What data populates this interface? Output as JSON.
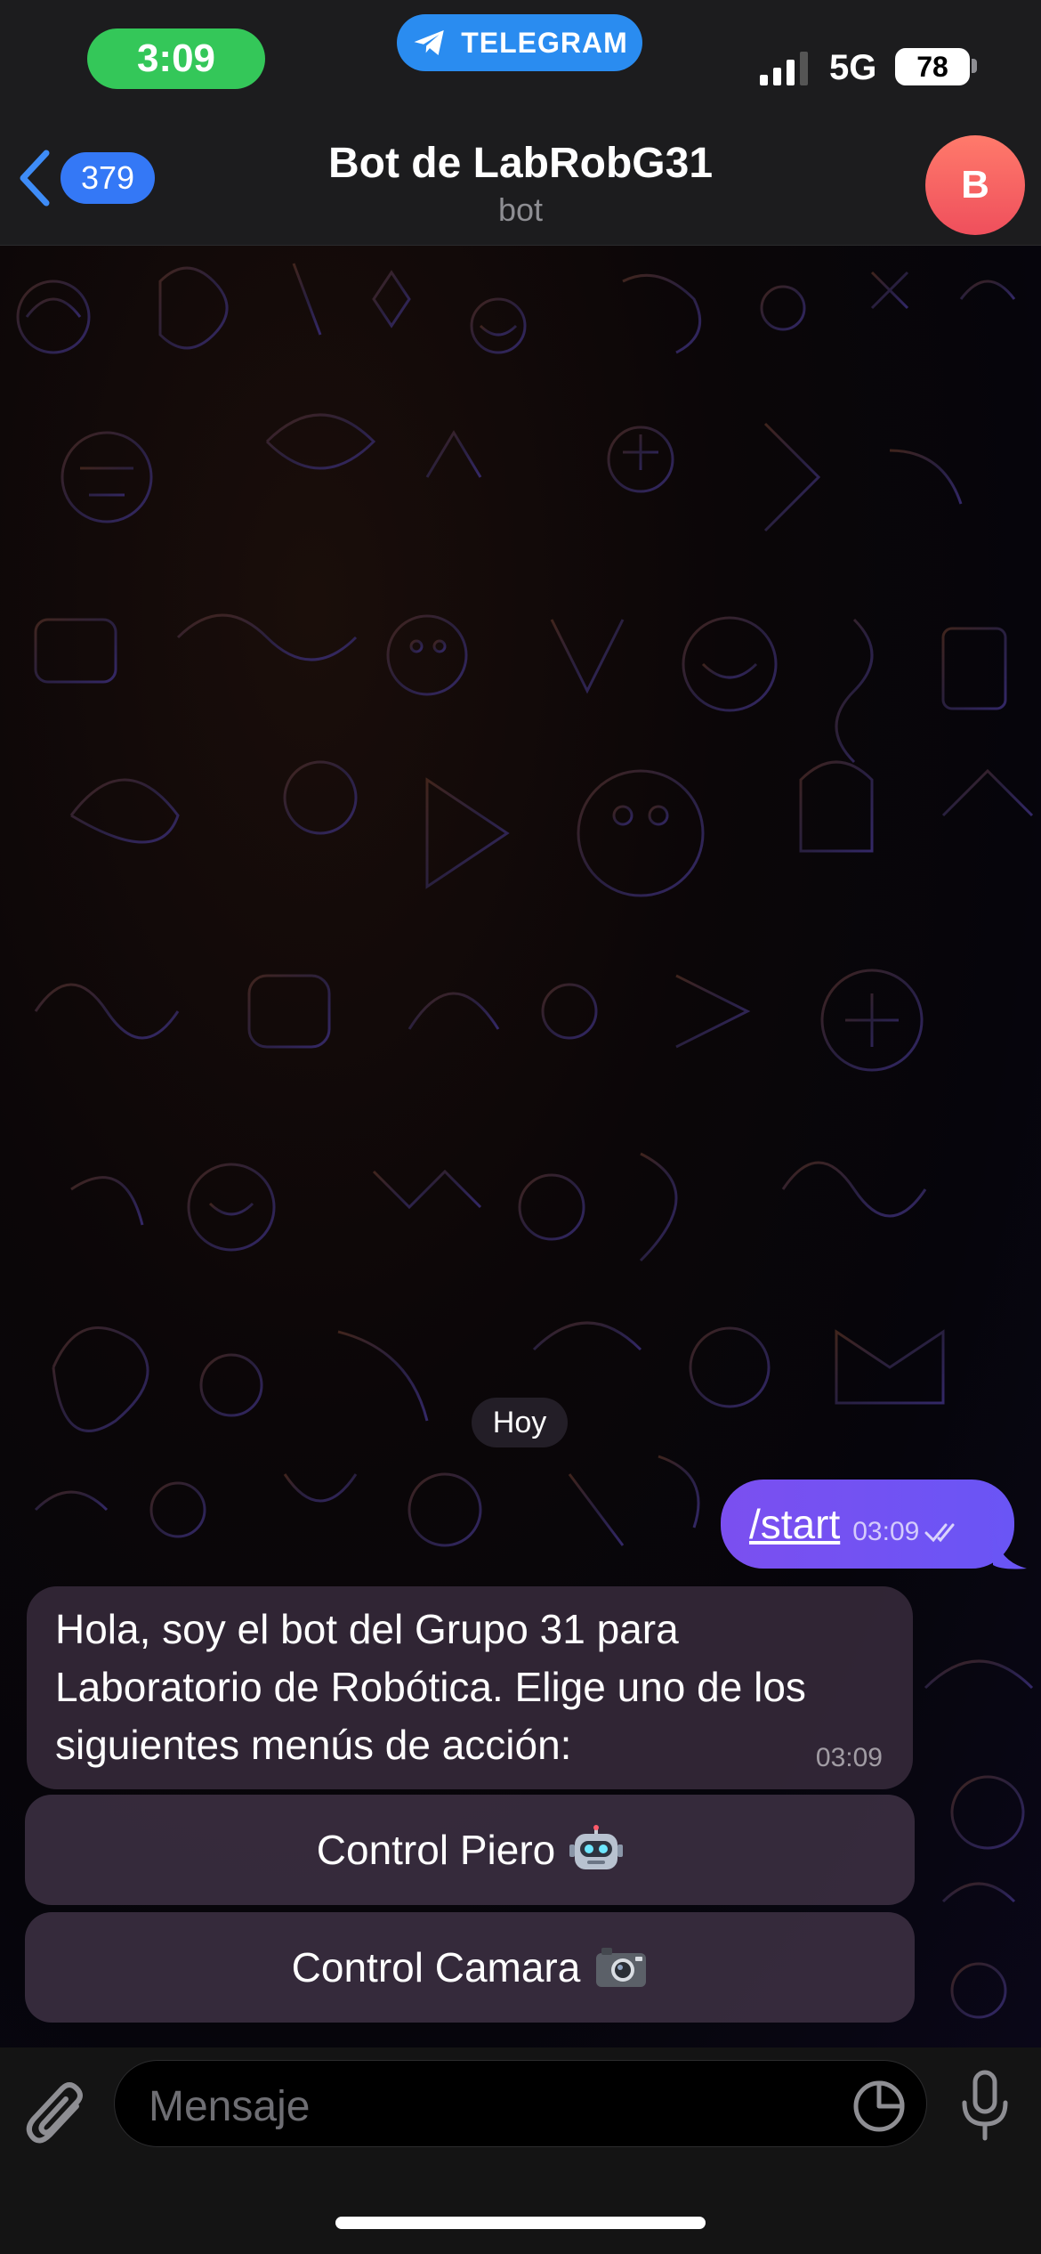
{
  "status_bar": {
    "time": "3:09",
    "app_pill_label": "TELEGRAM",
    "network": "5G",
    "battery": "78",
    "colors": {
      "time_pill": "#34c759",
      "app_pill": "#2a8cf0"
    }
  },
  "header": {
    "back_badge": "379",
    "title": "Bot de LabRobG31",
    "subtitle": "bot",
    "avatar_letter": "B",
    "back_icon": "chevron-left-icon"
  },
  "chat": {
    "date_separator": "Hoy",
    "outgoing": {
      "text": "/start",
      "time": "03:09",
      "status_icon": "double-check-icon"
    },
    "incoming": {
      "text": "Hola, soy el bot del Grupo 31 para Laboratorio de Robótica. Elige uno de los siguientes menús de acción:",
      "time": "03:09"
    },
    "inline_keyboard": [
      {
        "label": "Control Piero",
        "icon": "robot-face-icon"
      },
      {
        "label": "Control Camara",
        "icon": "camera-icon"
      }
    ]
  },
  "composer": {
    "placeholder": "Mensaje",
    "attach_icon": "paperclip-icon",
    "sticker_icon": "sticker-icon",
    "mic_icon": "microphone-icon"
  }
}
